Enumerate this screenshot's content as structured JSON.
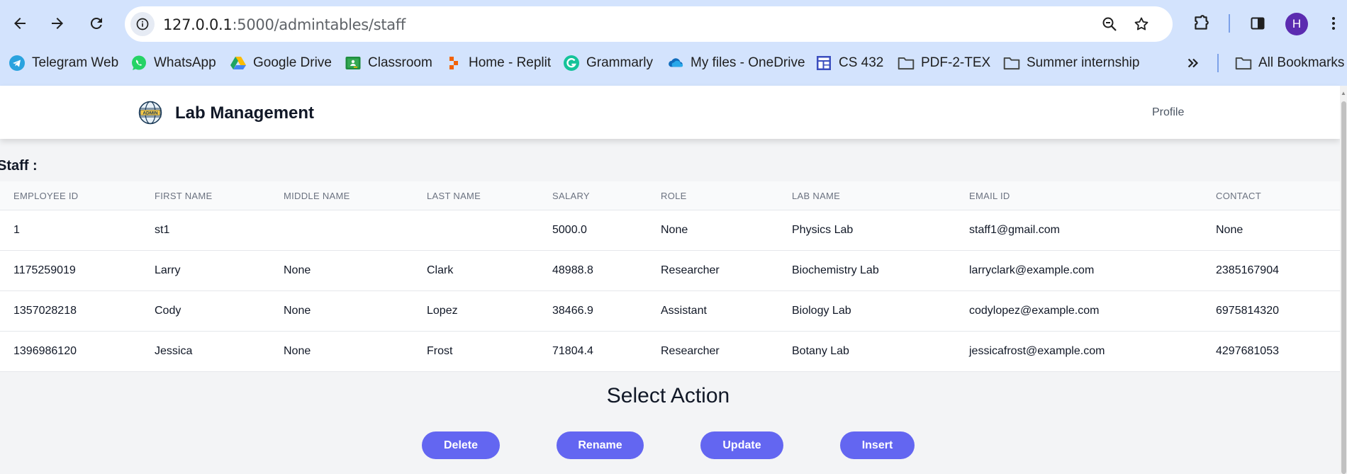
{
  "browser": {
    "url_host": "127.0.0.1",
    "url_path": ":5000/admintables/staff",
    "avatar_letter": "H",
    "bookmarks": [
      {
        "label": "Telegram Web",
        "icon": "telegram-icon"
      },
      {
        "label": "WhatsApp",
        "icon": "whatsapp-icon"
      },
      {
        "label": "Google Drive",
        "icon": "google-drive-icon"
      },
      {
        "label": "Classroom",
        "icon": "classroom-icon"
      },
      {
        "label": "Home - Replit",
        "icon": "replit-icon"
      },
      {
        "label": "Grammarly",
        "icon": "grammarly-icon"
      },
      {
        "label": "My files - OneDrive",
        "icon": "onedrive-icon"
      },
      {
        "label": "CS 432",
        "icon": "app-grid-icon"
      },
      {
        "label": "PDF-2-TEX",
        "icon": "folder-icon"
      },
      {
        "label": "Summer internship",
        "icon": "folder-icon"
      }
    ],
    "all_bookmarks_label": "All Bookmarks"
  },
  "header": {
    "app_title": "Lab Management",
    "profile_label": "Profile",
    "logo_text": "ADMIN"
  },
  "section_title": "Staff :",
  "table": {
    "columns": [
      "EMPLOYEE ID",
      "FIRST NAME",
      "MIDDLE NAME",
      "LAST NAME",
      "SALARY",
      "ROLE",
      "LAB NAME",
      "EMAIL ID",
      "CONTACT"
    ],
    "rows": [
      [
        "1",
        "st1",
        "",
        "",
        "5000.0",
        "None",
        "Physics Lab",
        "staff1@gmail.com",
        "None"
      ],
      [
        "1175259019",
        "Larry",
        "None",
        "Clark",
        "48988.8",
        "Researcher",
        "Biochemistry Lab",
        "larryclark@example.com",
        "2385167904"
      ],
      [
        "1357028218",
        "Cody",
        "None",
        "Lopez",
        "38466.9",
        "Assistant",
        "Biology Lab",
        "codylopez@example.com",
        "6975814320"
      ],
      [
        "1396986120",
        "Jessica",
        "None",
        "Frost",
        "71804.4",
        "Researcher",
        "Botany Lab",
        "jessicafrost@example.com",
        "4297681053"
      ]
    ]
  },
  "actions": {
    "title": "Select Action",
    "buttons": [
      "Delete",
      "Rename",
      "Update",
      "Insert"
    ]
  },
  "colors": {
    "accent": "#6366f1",
    "chrome": "#d3e3fd"
  }
}
